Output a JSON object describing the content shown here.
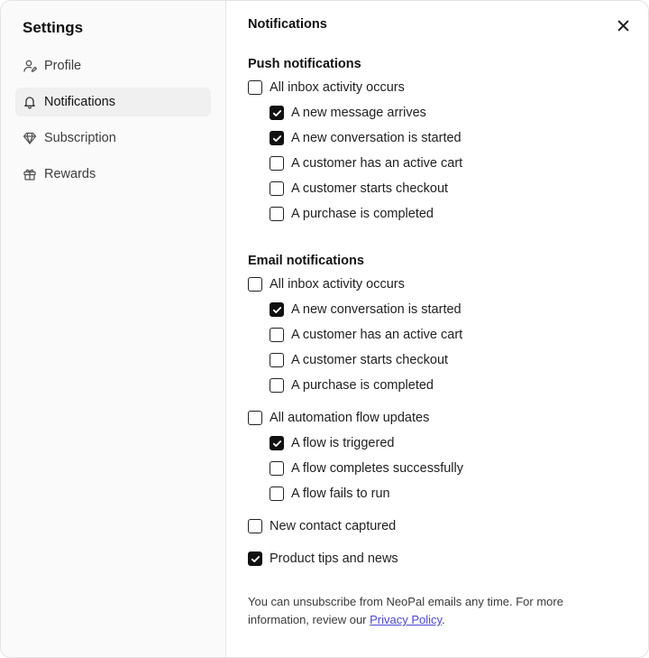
{
  "sidebar": {
    "title": "Settings",
    "items": [
      {
        "label": "Profile",
        "icon": "user-icon",
        "active": false
      },
      {
        "label": "Notifications",
        "icon": "bell-icon",
        "active": true
      },
      {
        "label": "Subscription",
        "icon": "diamond-icon",
        "active": false
      },
      {
        "label": "Rewards",
        "icon": "gift-icon",
        "active": false
      }
    ]
  },
  "panel": {
    "title": "Notifications",
    "close_icon": "close-icon"
  },
  "push": {
    "heading": "Push notifications",
    "parent": {
      "label": "All inbox activity occurs",
      "checked": false
    },
    "children": [
      {
        "label": "A new message arrives",
        "checked": true
      },
      {
        "label": "A new conversation is started",
        "checked": true
      },
      {
        "label": "A customer has an active cart",
        "checked": false
      },
      {
        "label": "A customer starts checkout",
        "checked": false
      },
      {
        "label": "A purchase is completed",
        "checked": false
      }
    ]
  },
  "email": {
    "heading": "Email notifications",
    "inbox_parent": {
      "label": "All inbox activity occurs",
      "checked": false
    },
    "inbox_children": [
      {
        "label": "A new conversation is started",
        "checked": true
      },
      {
        "label": "A customer has an active cart",
        "checked": false
      },
      {
        "label": "A customer starts checkout",
        "checked": false
      },
      {
        "label": "A purchase is completed",
        "checked": false
      }
    ],
    "flow_parent": {
      "label": "All automation flow updates",
      "checked": false
    },
    "flow_children": [
      {
        "label": "A flow is triggered",
        "checked": true
      },
      {
        "label": "A flow completes successfully",
        "checked": false
      },
      {
        "label": "A flow fails to run",
        "checked": false
      }
    ],
    "new_contact": {
      "label": "New contact captured",
      "checked": false
    },
    "product_tips": {
      "label": "Product tips and news",
      "checked": true
    }
  },
  "footer": {
    "text": "You can unsubscribe from NeoPal emails any time. For more information, review our ",
    "link": "Privacy Policy",
    "end": "."
  },
  "colors": {
    "accent": "#111111",
    "link": "#4b47d6"
  }
}
